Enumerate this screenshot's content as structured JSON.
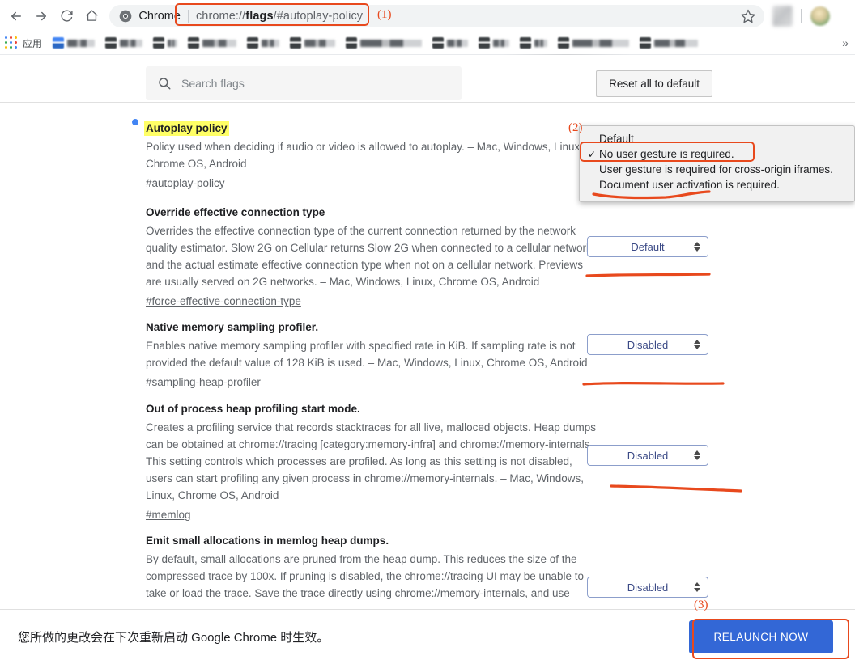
{
  "browser": {
    "nav": {
      "back": "back-arrow",
      "forward": "forward-arrow",
      "reload": "reload",
      "home": "home"
    },
    "omnibox": {
      "chrome_label": "Chrome",
      "url_prefix": "chrome://",
      "url_bold": "flags",
      "url_suffix": "/#autoplay-policy",
      "star": "bookmark-star"
    },
    "bookmarks": {
      "apps_label": "应用",
      "overflow": "»"
    }
  },
  "flags_page": {
    "search": {
      "placeholder": "Search flags"
    },
    "reset_button": "Reset all to default",
    "flags": [
      {
        "title": "Autoplay policy",
        "highlighted": true,
        "description": "Policy used when deciding if audio or video is allowed to autoplay. – Mac, Windows, Linux, Chrome OS, Android",
        "permalink": "#autoplay-policy",
        "control": "popup"
      },
      {
        "title": "Override effective connection type",
        "highlighted": false,
        "description": "Overrides the effective connection type of the current connection returned by the network quality estimator. Slow 2G on Cellular returns Slow 2G when connected to a cellular network, and the actual estimate effective connection type when not on a cellular network. Previews are usually served on 2G networks. – Mac, Windows, Linux, Chrome OS, Android",
        "permalink": "#force-effective-connection-type",
        "control": "select",
        "value": "Default"
      },
      {
        "title": "Native memory sampling profiler.",
        "highlighted": false,
        "description": "Enables native memory sampling profiler with specified rate in KiB. If sampling rate is not provided the default value of 128 KiB is used. – Mac, Windows, Linux, Chrome OS, Android",
        "permalink": "#sampling-heap-profiler",
        "control": "select",
        "value": "Disabled"
      },
      {
        "title": "Out of process heap profiling start mode.",
        "highlighted": false,
        "description": "Creates a profiling service that records stacktraces for all live, malloced objects. Heap dumps can be obtained at chrome://tracing [category:memory-infra] and chrome://memory-internals. This setting controls which processes are profiled. As long as this setting is not disabled, users can start profiling any given process in chrome://memory-internals. – Mac, Windows, Linux, Chrome OS, Android",
        "permalink": "#memlog",
        "control": "select",
        "value": "Disabled"
      },
      {
        "title": "Emit small allocations in memlog heap dumps.",
        "highlighted": false,
        "description": "By default, small allocations are pruned from the heap dump. This reduces the size of the compressed trace by 100x. If pruning is disabled, the chrome://tracing UI may be unable to take or load the trace. Save the trace directly using chrome://memory-internals, and use",
        "permalink": "",
        "control": "select-partial",
        "value": "Disabled"
      }
    ],
    "open_dropdown": {
      "options": [
        {
          "label": "Default",
          "checked": false
        },
        {
          "label": "No user gesture is required.",
          "checked": true
        },
        {
          "label": "User gesture is required for cross-origin iframes.",
          "checked": false
        },
        {
          "label": "Document user activation is required.",
          "checked": false
        }
      ],
      "check_glyph": "✓"
    }
  },
  "bottom_bar": {
    "message": "您所做的更改会在下次重新启动 Google Chrome 时生效。",
    "relaunch_label": "RELAUNCH NOW"
  },
  "annotations": {
    "one": "(1)",
    "two": "(2)",
    "three": "(3)",
    "color": "#e8491d"
  }
}
